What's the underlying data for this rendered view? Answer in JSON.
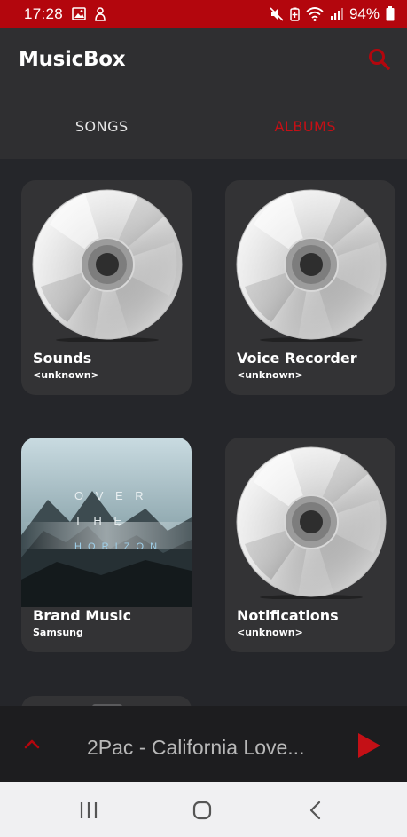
{
  "status_bar": {
    "time": "17:28",
    "battery": "94%",
    "color": "#b3060d"
  },
  "app": {
    "title": "MusicBox"
  },
  "tabs": [
    {
      "label": "SONGS",
      "active": false
    },
    {
      "label": "ALBUMS",
      "active": true
    }
  ],
  "albums": [
    {
      "title": "Sounds",
      "artist": "<unknown>",
      "art": "cd-disc-icon"
    },
    {
      "title": "Voice Recorder",
      "artist": "<unknown>",
      "art": "cd-disc-icon"
    },
    {
      "title": "Brand Music",
      "artist": "Samsung",
      "art": "over-the-horizon-cover",
      "cover_text": [
        "O V E R",
        "T H E",
        "H O R I Z O N"
      ]
    },
    {
      "title": "Notifications",
      "artist": "<unknown>",
      "art": "cd-disc-icon"
    }
  ],
  "now_playing": {
    "track": "2Pac - California Love..."
  },
  "colors": {
    "accent": "#c41016",
    "background": "#25262a",
    "card": "#333335"
  }
}
